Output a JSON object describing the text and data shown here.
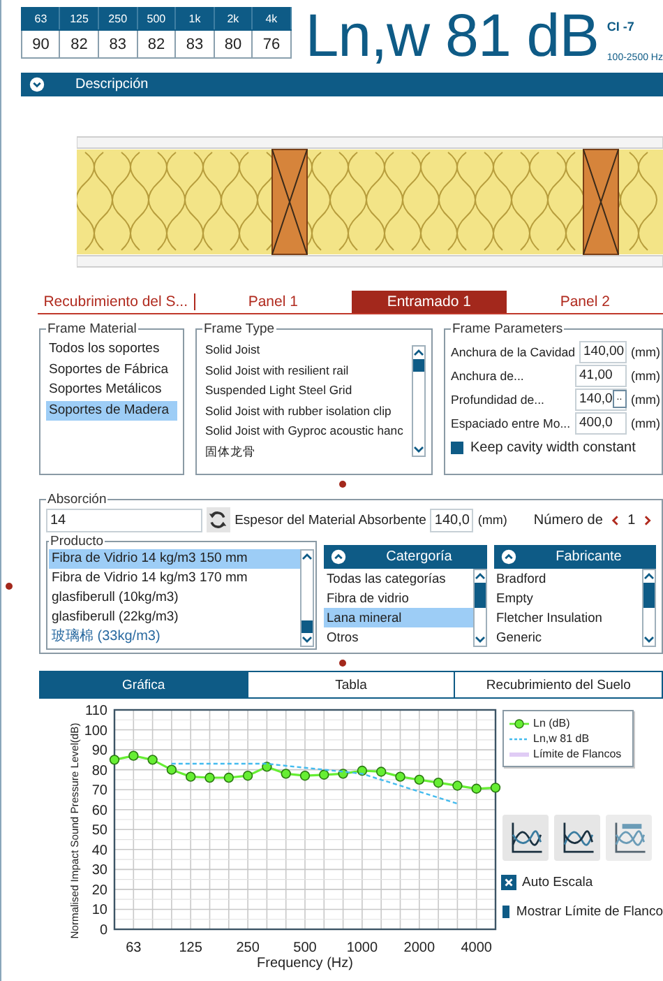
{
  "octave_table": {
    "bands": [
      {
        "band": "63",
        "value": "90"
      },
      {
        "band": "125",
        "value": "82"
      },
      {
        "band": "250",
        "value": "83"
      },
      {
        "band": "500",
        "value": "82"
      },
      {
        "band": "1k",
        "value": "83"
      },
      {
        "band": "2k",
        "value": "80"
      },
      {
        "band": "4k",
        "value": "76"
      }
    ]
  },
  "rating": {
    "value": "Ln,w 81 dB",
    "ci": "CI -7",
    "range": "100-2500 Hz"
  },
  "description_bar": {
    "title": "Descripción"
  },
  "layer_tabs": [
    {
      "label": "Recubrimiento del S...",
      "selected": false
    },
    {
      "label": "Panel 1",
      "selected": false
    },
    {
      "label": "Entramado 1",
      "selected": true
    },
    {
      "label": "Panel 2",
      "selected": false
    }
  ],
  "frame_material": {
    "title": "Frame Material",
    "items": [
      {
        "label": "Todos los soportes",
        "selected": false
      },
      {
        "label": "Soportes de Fábrica",
        "selected": false
      },
      {
        "label": "Soportes Metálicos",
        "selected": false
      },
      {
        "label": "Soportes de Madera",
        "selected": true
      }
    ]
  },
  "frame_type": {
    "title": "Frame Type",
    "items": [
      {
        "label": "Solid Joist",
        "selected": false
      },
      {
        "label": "Solid Joist with resilient rail",
        "selected": false
      },
      {
        "label": "Suspended Light Steel Grid",
        "selected": false
      },
      {
        "label": "Solid Joist with rubber isolation clip",
        "selected": false
      },
      {
        "label": "Solid Joist with Gyproc acoustic hanc",
        "selected": false
      },
      {
        "label": "固体龙骨",
        "selected": false
      }
    ]
  },
  "frame_parameters": {
    "title": "Frame Parameters",
    "fields": [
      {
        "label": "Anchura de la Cavidad",
        "value": "140,00",
        "unit": "(mm)",
        "kind": "plain"
      },
      {
        "label": "Anchura de...",
        "value": "41,00",
        "unit": "(mm)",
        "kind": "plain"
      },
      {
        "label": "Profundidad de...",
        "value": "140,0",
        "unit": "(mm)",
        "kind": "browse",
        "button": ".."
      },
      {
        "label": "Espaciado entre Mo...",
        "value": "400,0",
        "unit": "(mm)",
        "kind": "plain"
      }
    ],
    "keep_constant": {
      "label": "Keep cavity width constant",
      "checked": false
    }
  },
  "absorption": {
    "title": "Absorción",
    "search_value": "14",
    "thickness_label": "Espesor del Material Absorbente",
    "thickness_value": "140,0",
    "thickness_unit": "(mm)",
    "number_label": "Número de",
    "number_value": "1",
    "product": {
      "title": "Producto",
      "items": [
        {
          "label": "Fibra de Vidrio 14 kg/m3 150 mm",
          "selected": true
        },
        {
          "label": "Fibra de Vidrio 14 kg/m3 170 mm",
          "selected": false
        },
        {
          "label": "glasfiberull (10kg/m3)",
          "selected": false
        },
        {
          "label": "glasfiberull (22kg/m3)",
          "selected": false
        },
        {
          "label": "玻璃棉 (33kg/m3)",
          "selected": false
        }
      ]
    },
    "category": {
      "title": "Catergoría",
      "items": [
        {
          "label": "Todas las categorías",
          "selected": false
        },
        {
          "label": "Fibra de vidrio",
          "selected": false
        },
        {
          "label": "Lana mineral",
          "selected": true
        },
        {
          "label": "Otros",
          "selected": false
        }
      ]
    },
    "manufacturer": {
      "title": "Fabricante",
      "items": [
        {
          "label": "Bradford",
          "selected": false
        },
        {
          "label": "Empty",
          "selected": false
        },
        {
          "label": "Fletcher Insulation",
          "selected": false
        },
        {
          "label": "Generic",
          "selected": false
        }
      ]
    }
  },
  "result_tabs": [
    {
      "label": "Gráfica",
      "selected": true
    },
    {
      "label": "Tabla",
      "selected": false
    },
    {
      "label": "Recubrimiento del Suelo",
      "selected": false
    }
  ],
  "chart": {
    "chart_data": {
      "type": "line",
      "xlabel": "Frequency (Hz)",
      "ylabel": "Normalised Impact Sound Pressure Level(dB)",
      "categories": [
        null,
        "63",
        null,
        null,
        "125",
        null,
        null,
        "250",
        null,
        null,
        "500",
        null,
        null,
        "1000",
        null,
        null,
        "2000",
        null,
        null,
        "4000",
        null
      ],
      "grid": true,
      "series": [
        {
          "name": "Ln (dB)",
          "color": "#66ee33",
          "marker": "circle",
          "line_style": "solid",
          "values": [
            85,
            87,
            85,
            80,
            76.5,
            76,
            76,
            77,
            81.5,
            78,
            77,
            77.5,
            78,
            79.5,
            79,
            76.5,
            75,
            73.5,
            72,
            70.5,
            71
          ]
        },
        {
          "name": "Ln,w 81 dB",
          "color": "#44bbee",
          "line_style": "dashed",
          "values": [
            null,
            null,
            null,
            83,
            83,
            83,
            83,
            83,
            83,
            82,
            81,
            80,
            79,
            78,
            75,
            72,
            69,
            66,
            63,
            null,
            null
          ]
        },
        {
          "name": "Límite de Flancos",
          "color": "#e0ccf5",
          "line_style": "band",
          "values": [
            null,
            null,
            null,
            null,
            null,
            null,
            null,
            null,
            null,
            null,
            null,
            null,
            null,
            null,
            null,
            null,
            null,
            null,
            null,
            null,
            null
          ]
        }
      ],
      "ylim": [
        0,
        110
      ],
      "yticks": [
        0,
        10,
        20,
        30,
        40,
        50,
        60,
        70,
        80,
        90,
        100,
        110
      ]
    }
  },
  "chart_options": [
    {
      "label": "Auto Escala",
      "checked": true
    },
    {
      "label": "Mostrar Límite de Flanco",
      "checked": false
    }
  ]
}
